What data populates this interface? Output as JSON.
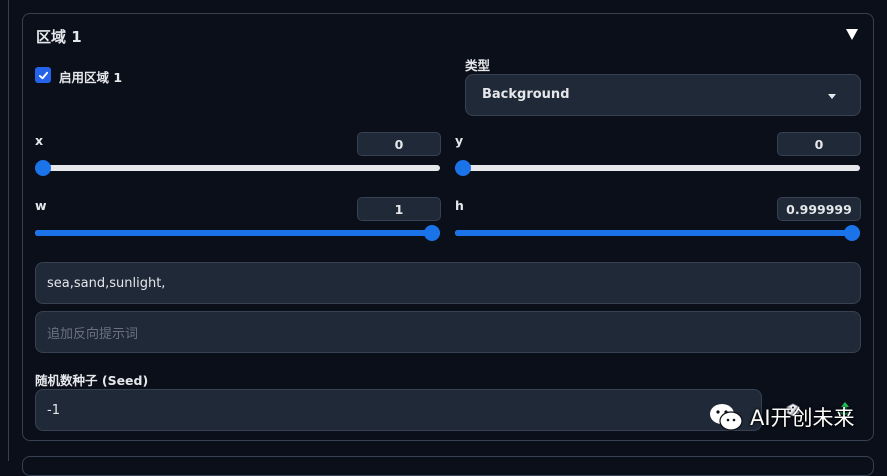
{
  "region": {
    "title": "区域 1",
    "enable_label": "启用区域 1",
    "enabled": true,
    "type_label": "类型",
    "type_value": "Background",
    "x": {
      "label": "x",
      "value": "0",
      "fraction": 0.0
    },
    "y": {
      "label": "y",
      "value": "0",
      "fraction": 0.0
    },
    "w": {
      "label": "w",
      "value": "1",
      "fraction": 1.0
    },
    "h": {
      "label": "h",
      "value": "0.999999",
      "fraction": 1.0
    },
    "prompt_value": "sea,sand,sunlight,",
    "negative_prompt_placeholder": "追加反向提示词",
    "seed_label": "随机数种子 (Seed)",
    "seed_value": "-1"
  },
  "watermark": {
    "text": "AI开创未来",
    "icon": "wechat-icon"
  },
  "colors": {
    "background": "#0b0f19",
    "accent": "#1a73e8",
    "checkbox": "#2563eb",
    "input_bg": "#1f2937",
    "border": "#374151"
  }
}
